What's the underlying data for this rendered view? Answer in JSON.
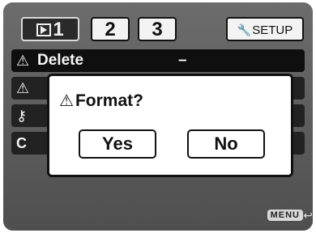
{
  "tabs": [
    {
      "label": "1",
      "icon": "playback-icon"
    },
    {
      "label": "2"
    },
    {
      "label": "3"
    },
    {
      "label": "SETUP",
      "icon": "wrench-icon"
    }
  ],
  "rows": [
    {
      "icon": "warning-icon",
      "label": "Delete",
      "value": "–"
    },
    {
      "icon": "warning-icon",
      "label": ""
    },
    {
      "icon": "key-icon",
      "label": ""
    },
    {
      "icon": "",
      "label": "C"
    }
  ],
  "dialog": {
    "title": "Format?",
    "yes": "Yes",
    "no": "No"
  },
  "footer": {
    "menu_label": "MENU"
  }
}
